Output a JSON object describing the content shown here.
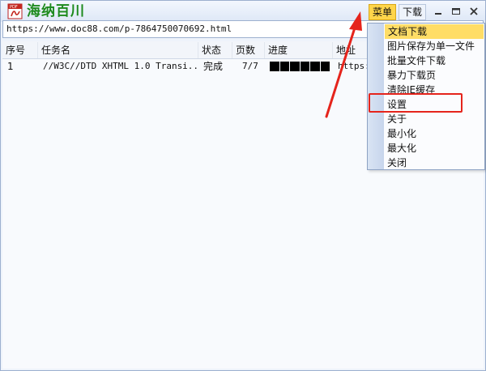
{
  "app": {
    "title": "海纳百川",
    "menu_label": "菜单",
    "download_label": "下载",
    "min_glyph": "▬",
    "max_glyph": "▭",
    "close_glyph": "✕"
  },
  "url_bar": {
    "value": "https://www.doc88.com/p-7864750070692.html"
  },
  "table": {
    "headers": [
      "序号",
      "任务名",
      "状态",
      "页数",
      "进度",
      "地址"
    ],
    "rows": [
      {
        "index": "1",
        "name": "//W3C//DTD XHTML 1.0 Transi...",
        "status": "完成",
        "pages": "7/7",
        "progress": 1.0,
        "address": "https:"
      }
    ]
  },
  "dropdown": {
    "items": [
      {
        "label": "文档下载",
        "highlighted": true
      },
      {
        "label": "图片保存为单一文件"
      },
      {
        "label": "批量文件下载"
      },
      {
        "label": "暴力下载页"
      },
      {
        "label": "清除IE缓存"
      },
      {
        "label": "设置",
        "annotated": true
      },
      {
        "label": "关于"
      },
      {
        "label": "最小化"
      },
      {
        "label": "最大化"
      },
      {
        "label": "关闭"
      }
    ]
  },
  "colors": {
    "title_green": "#1d8a1d",
    "menu_yellow": "#ffd54a",
    "annotation_red": "#e5241c"
  },
  "icons": {
    "app": "pdf-icon",
    "minimize": "minimize-icon",
    "maximize": "maximize-icon",
    "close": "close-icon"
  }
}
